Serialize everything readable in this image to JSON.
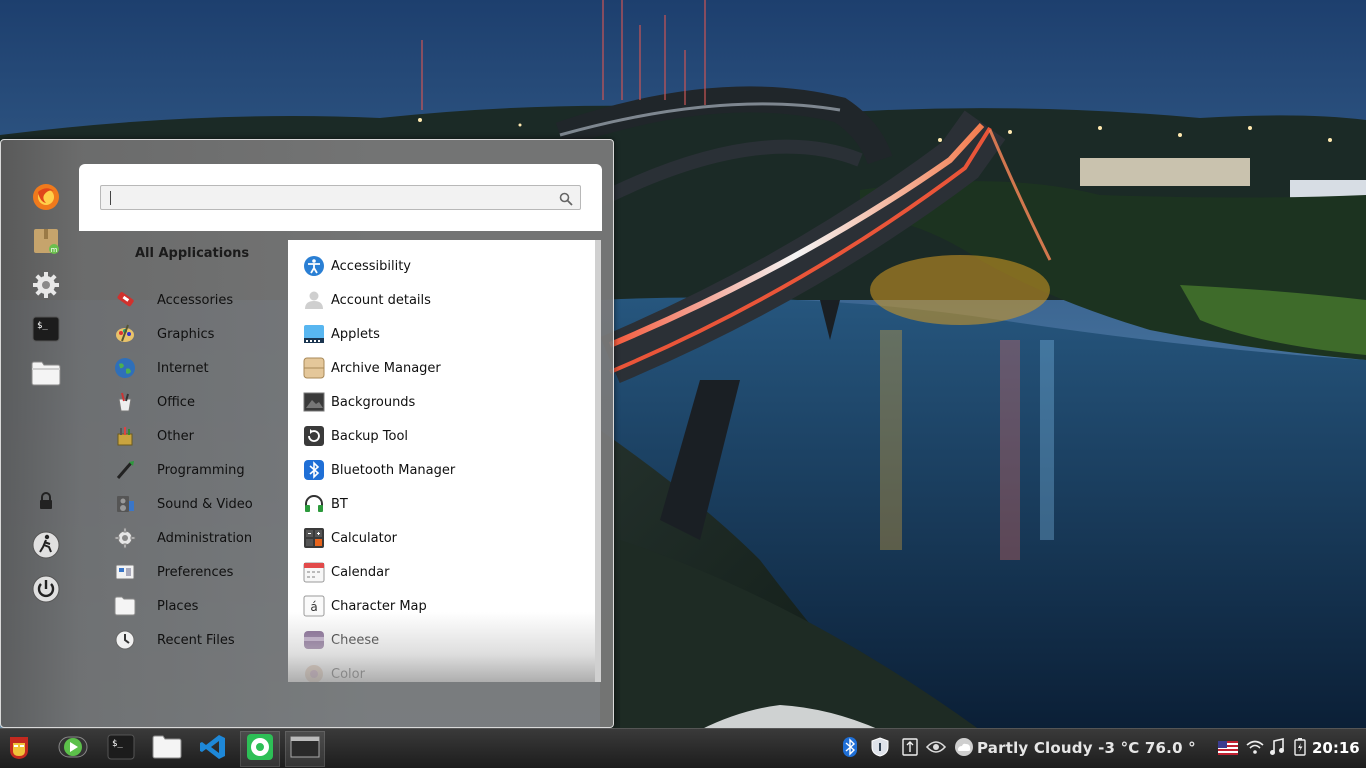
{
  "wallpaper": {
    "description_icon": "night-bridge-landscape"
  },
  "menu": {
    "search": {
      "value": "",
      "placeholder": ""
    },
    "favorites": [
      {
        "name": "Firefox",
        "icon": "firefox-icon"
      },
      {
        "name": "Software Manager",
        "icon": "package-icon"
      },
      {
        "name": "System Settings",
        "icon": "gear-icon"
      },
      {
        "name": "Terminal",
        "icon": "terminal-icon"
      },
      {
        "name": "Files",
        "icon": "folder-icon"
      }
    ],
    "session": [
      {
        "name": "Lock Screen",
        "icon": "lock-icon"
      },
      {
        "name": "Logout",
        "icon": "logout-icon"
      },
      {
        "name": "Quit",
        "icon": "power-icon"
      }
    ],
    "categories_title": "All Applications",
    "categories": [
      {
        "label": "Accessories",
        "icon": "accessories-icon"
      },
      {
        "label": "Graphics",
        "icon": "graphics-icon"
      },
      {
        "label": "Internet",
        "icon": "internet-icon"
      },
      {
        "label": "Office",
        "icon": "office-icon"
      },
      {
        "label": "Other",
        "icon": "other-icon"
      },
      {
        "label": "Programming",
        "icon": "programming-icon"
      },
      {
        "label": "Sound & Video",
        "icon": "sound-video-icon"
      },
      {
        "label": "Administration",
        "icon": "administration-icon"
      },
      {
        "label": "Preferences",
        "icon": "preferences-icon"
      },
      {
        "label": "Places",
        "icon": "places-icon"
      },
      {
        "label": "Recent Files",
        "icon": "recent-files-icon"
      }
    ],
    "apps": [
      {
        "label": "Accessibility",
        "icon": "accessibility-icon"
      },
      {
        "label": "Account details",
        "icon": "account-icon"
      },
      {
        "label": "Applets",
        "icon": "applets-icon"
      },
      {
        "label": "Archive Manager",
        "icon": "archive-icon"
      },
      {
        "label": "Backgrounds",
        "icon": "backgrounds-icon"
      },
      {
        "label": "Backup Tool",
        "icon": "backup-icon"
      },
      {
        "label": "Bluetooth Manager",
        "icon": "bluetooth-icon"
      },
      {
        "label": "BT",
        "icon": "headset-icon"
      },
      {
        "label": "Calculator",
        "icon": "calculator-icon"
      },
      {
        "label": "Calendar",
        "icon": "calendar-icon"
      },
      {
        "label": "Character Map",
        "icon": "character-map-icon"
      },
      {
        "label": "Cheese",
        "icon": "cheese-icon"
      },
      {
        "label": "Color",
        "icon": "color-icon"
      }
    ],
    "character_map_glyph": "á"
  },
  "taskbar": {
    "launchers": [
      {
        "name": "Menu",
        "icon": "ironman-icon"
      },
      {
        "name": "Media Player",
        "icon": "media-player-icon"
      },
      {
        "name": "Terminal",
        "icon": "terminal-icon"
      },
      {
        "name": "Files",
        "icon": "folder-icon"
      },
      {
        "name": "VS Code",
        "icon": "vscode-icon"
      },
      {
        "name": "Chrome",
        "icon": "chrome-icon"
      }
    ],
    "tray": {
      "icons": [
        "bluetooth-icon",
        "shield-icon",
        "keyboard-info-icon",
        "nvidia-icon",
        "weather-cloud-icon"
      ],
      "weather": "Partly Cloudy  -3 °C 76.0 °",
      "right_icons": [
        "us-flag-icon",
        "wifi-icon",
        "music-icon",
        "battery-icon"
      ],
      "clock": "20:16"
    }
  },
  "colors": {
    "menu_bg": "#787878",
    "panel_white": "#ffffff",
    "taskbar_top": "#3a3a3a",
    "taskbar_bottom": "#1d1d1d",
    "firefox_orange": "#f07a1c",
    "bluetooth_blue": "#1f6fd6",
    "vscode_blue": "#1e88d8",
    "chrome_green": "#2dbf56"
  }
}
